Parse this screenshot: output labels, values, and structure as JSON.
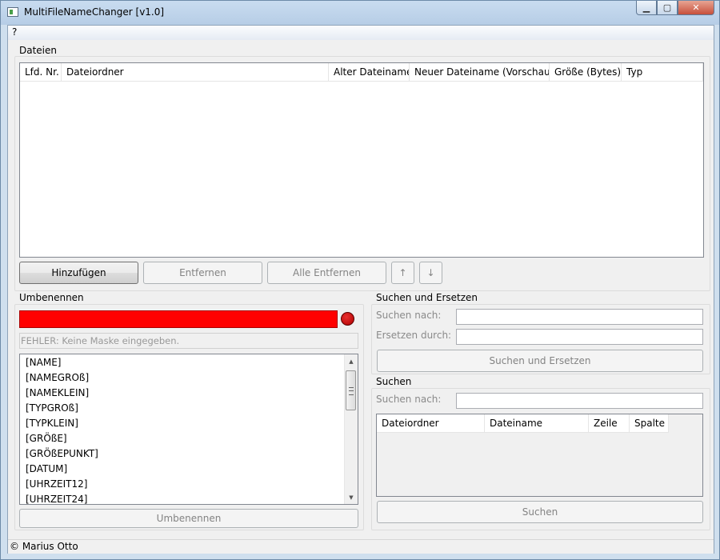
{
  "window": {
    "title": "MultiFileNameChanger [v1.0]"
  },
  "menu": {
    "help": "?"
  },
  "dateien": {
    "label": "Dateien",
    "columns": [
      "Lfd. Nr.",
      "Dateiordner",
      "Alter Dateiname",
      "Neuer Dateiname (Vorschau)",
      "Größe (Bytes)",
      "Typ"
    ],
    "buttons": {
      "add": "Hinzufügen",
      "remove": "Entfernen",
      "remove_all": "Alle Entfernen",
      "up": "↑",
      "down": "↓"
    }
  },
  "umbenennen": {
    "label": "Umbenennen",
    "mask_value": "",
    "status_color": "#ff0000",
    "error_text": "FEHLER: Keine Maske eingegeben.",
    "tags": [
      "[NAME]",
      "[NAMEGROß]",
      "[NAMEKLEIN]",
      "[TYPGROß]",
      "[TYPKLEIN]",
      "[GRÖßE]",
      "[GRÖßEPUNKT]",
      "[DATUM]",
      "[UHRZEIT12]",
      "[UHRZEIT24]"
    ],
    "rename_button": "Umbenennen"
  },
  "suchen_ersetzen": {
    "label": "Suchen und Ersetzen",
    "search_label": "Suchen nach:",
    "replace_label": "Ersetzen durch:",
    "button": "Suchen und Ersetzen"
  },
  "suchen": {
    "label": "Suchen",
    "search_label": "Suchen nach:",
    "columns": [
      "Dateiordner",
      "Dateiname",
      "Zeile",
      "Spalte"
    ],
    "button": "Suchen"
  },
  "status": {
    "copyright": "© Marius Otto"
  }
}
